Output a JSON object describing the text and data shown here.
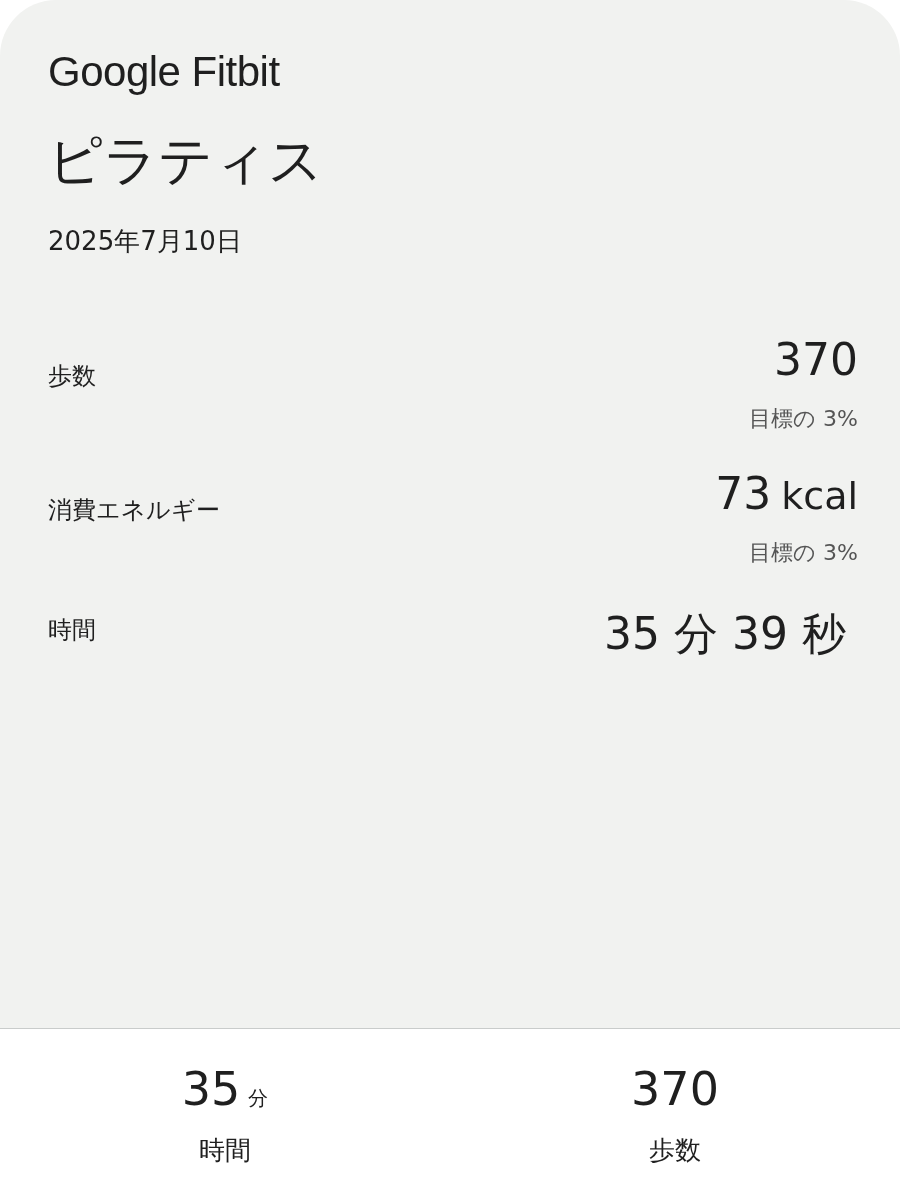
{
  "brand": "Google Fitbit",
  "title": "ピラティス",
  "date": "2025年7月10日",
  "metrics": [
    {
      "label": "歩数",
      "value": "370",
      "goal": "目標の 3%"
    },
    {
      "label": "消費エネルギー",
      "value": "73",
      "unit": "kcal",
      "goal": "目標の 3%"
    },
    {
      "label": "時間",
      "value": "35 分 39 秒"
    }
  ],
  "summary": [
    {
      "value": "35",
      "unit": "分",
      "label": "時間"
    },
    {
      "value": "370",
      "label": "歩数"
    }
  ]
}
